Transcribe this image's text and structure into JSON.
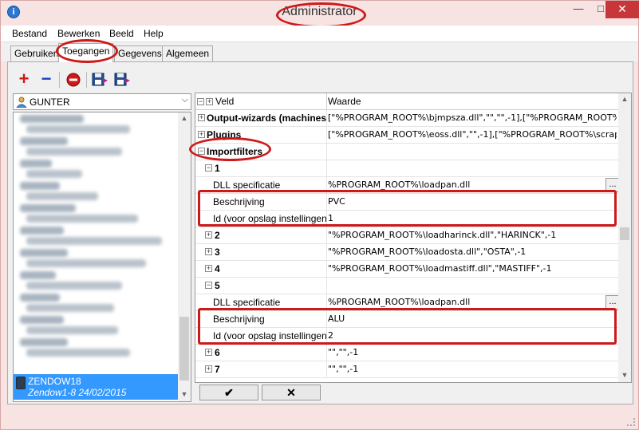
{
  "window": {
    "title": "Administrator",
    "app_icon_glyph": "i"
  },
  "menu": [
    "Bestand",
    "Bewerken",
    "Beeld",
    "Help"
  ],
  "tabs": [
    "Gebruikers",
    "Toegangen",
    "Gegevens",
    "Algemeen"
  ],
  "toolbar": {
    "add": "+",
    "remove": "−"
  },
  "user_combo": {
    "value": "GUNTER"
  },
  "user_list": {
    "selected": {
      "name": "ZENDOW18",
      "detail": "Zendow1-8 24/02/2015"
    }
  },
  "grid": {
    "header": {
      "field": "Veld",
      "value": "Waarde"
    },
    "rows": [
      {
        "label": "Output-wizards (machinest",
        "value": "[\"%PROGRAM_ROOT%\\bjmpsza.dll\",\"\",\"\",-1],[\"%PROGRAM_ROOT%\\mg2"
      },
      {
        "label": "Plugins",
        "value": "[\"%PROGRAM_ROOT%\\eoss.dll\",\"\",-1],[\"%PROGRAM_ROOT%\\scrapmn.d"
      },
      {
        "label": "Importfilters",
        "value": ""
      },
      {
        "label": "1",
        "value": ""
      },
      {
        "label": "DLL specificatie",
        "value": "%PROGRAM_ROOT%\\loadpan.dll"
      },
      {
        "label": "Beschrijving",
        "value": "PVC"
      },
      {
        "label": "Id (voor opslag instellingen)",
        "value": "1"
      },
      {
        "label": "2",
        "value": "\"%PROGRAM_ROOT%\\loadharinck.dll\",\"HARINCK\",-1"
      },
      {
        "label": "3",
        "value": "\"%PROGRAM_ROOT%\\loadosta.dll\",\"OSTA\",-1"
      },
      {
        "label": "4",
        "value": "\"%PROGRAM_ROOT%\\loadmastiff.dll\",\"MASTIFF\",-1"
      },
      {
        "label": "5",
        "value": ""
      },
      {
        "label": "DLL specificatie",
        "value": "%PROGRAM_ROOT%\\loadpan.dll"
      },
      {
        "label": "Beschrijving",
        "value": "ALU"
      },
      {
        "label": "Id (voor opslag instellingen)",
        "value": "2"
      },
      {
        "label": "6",
        "value": "\"\",\"\",-1"
      },
      {
        "label": "7",
        "value": "\"\",\"\",-1"
      }
    ],
    "ellipsis": "..."
  },
  "buttons": {
    "ok": "✔",
    "cancel": "✕"
  },
  "colors": {
    "highlight": "#cc1a1a",
    "selection": "#3399ff"
  }
}
